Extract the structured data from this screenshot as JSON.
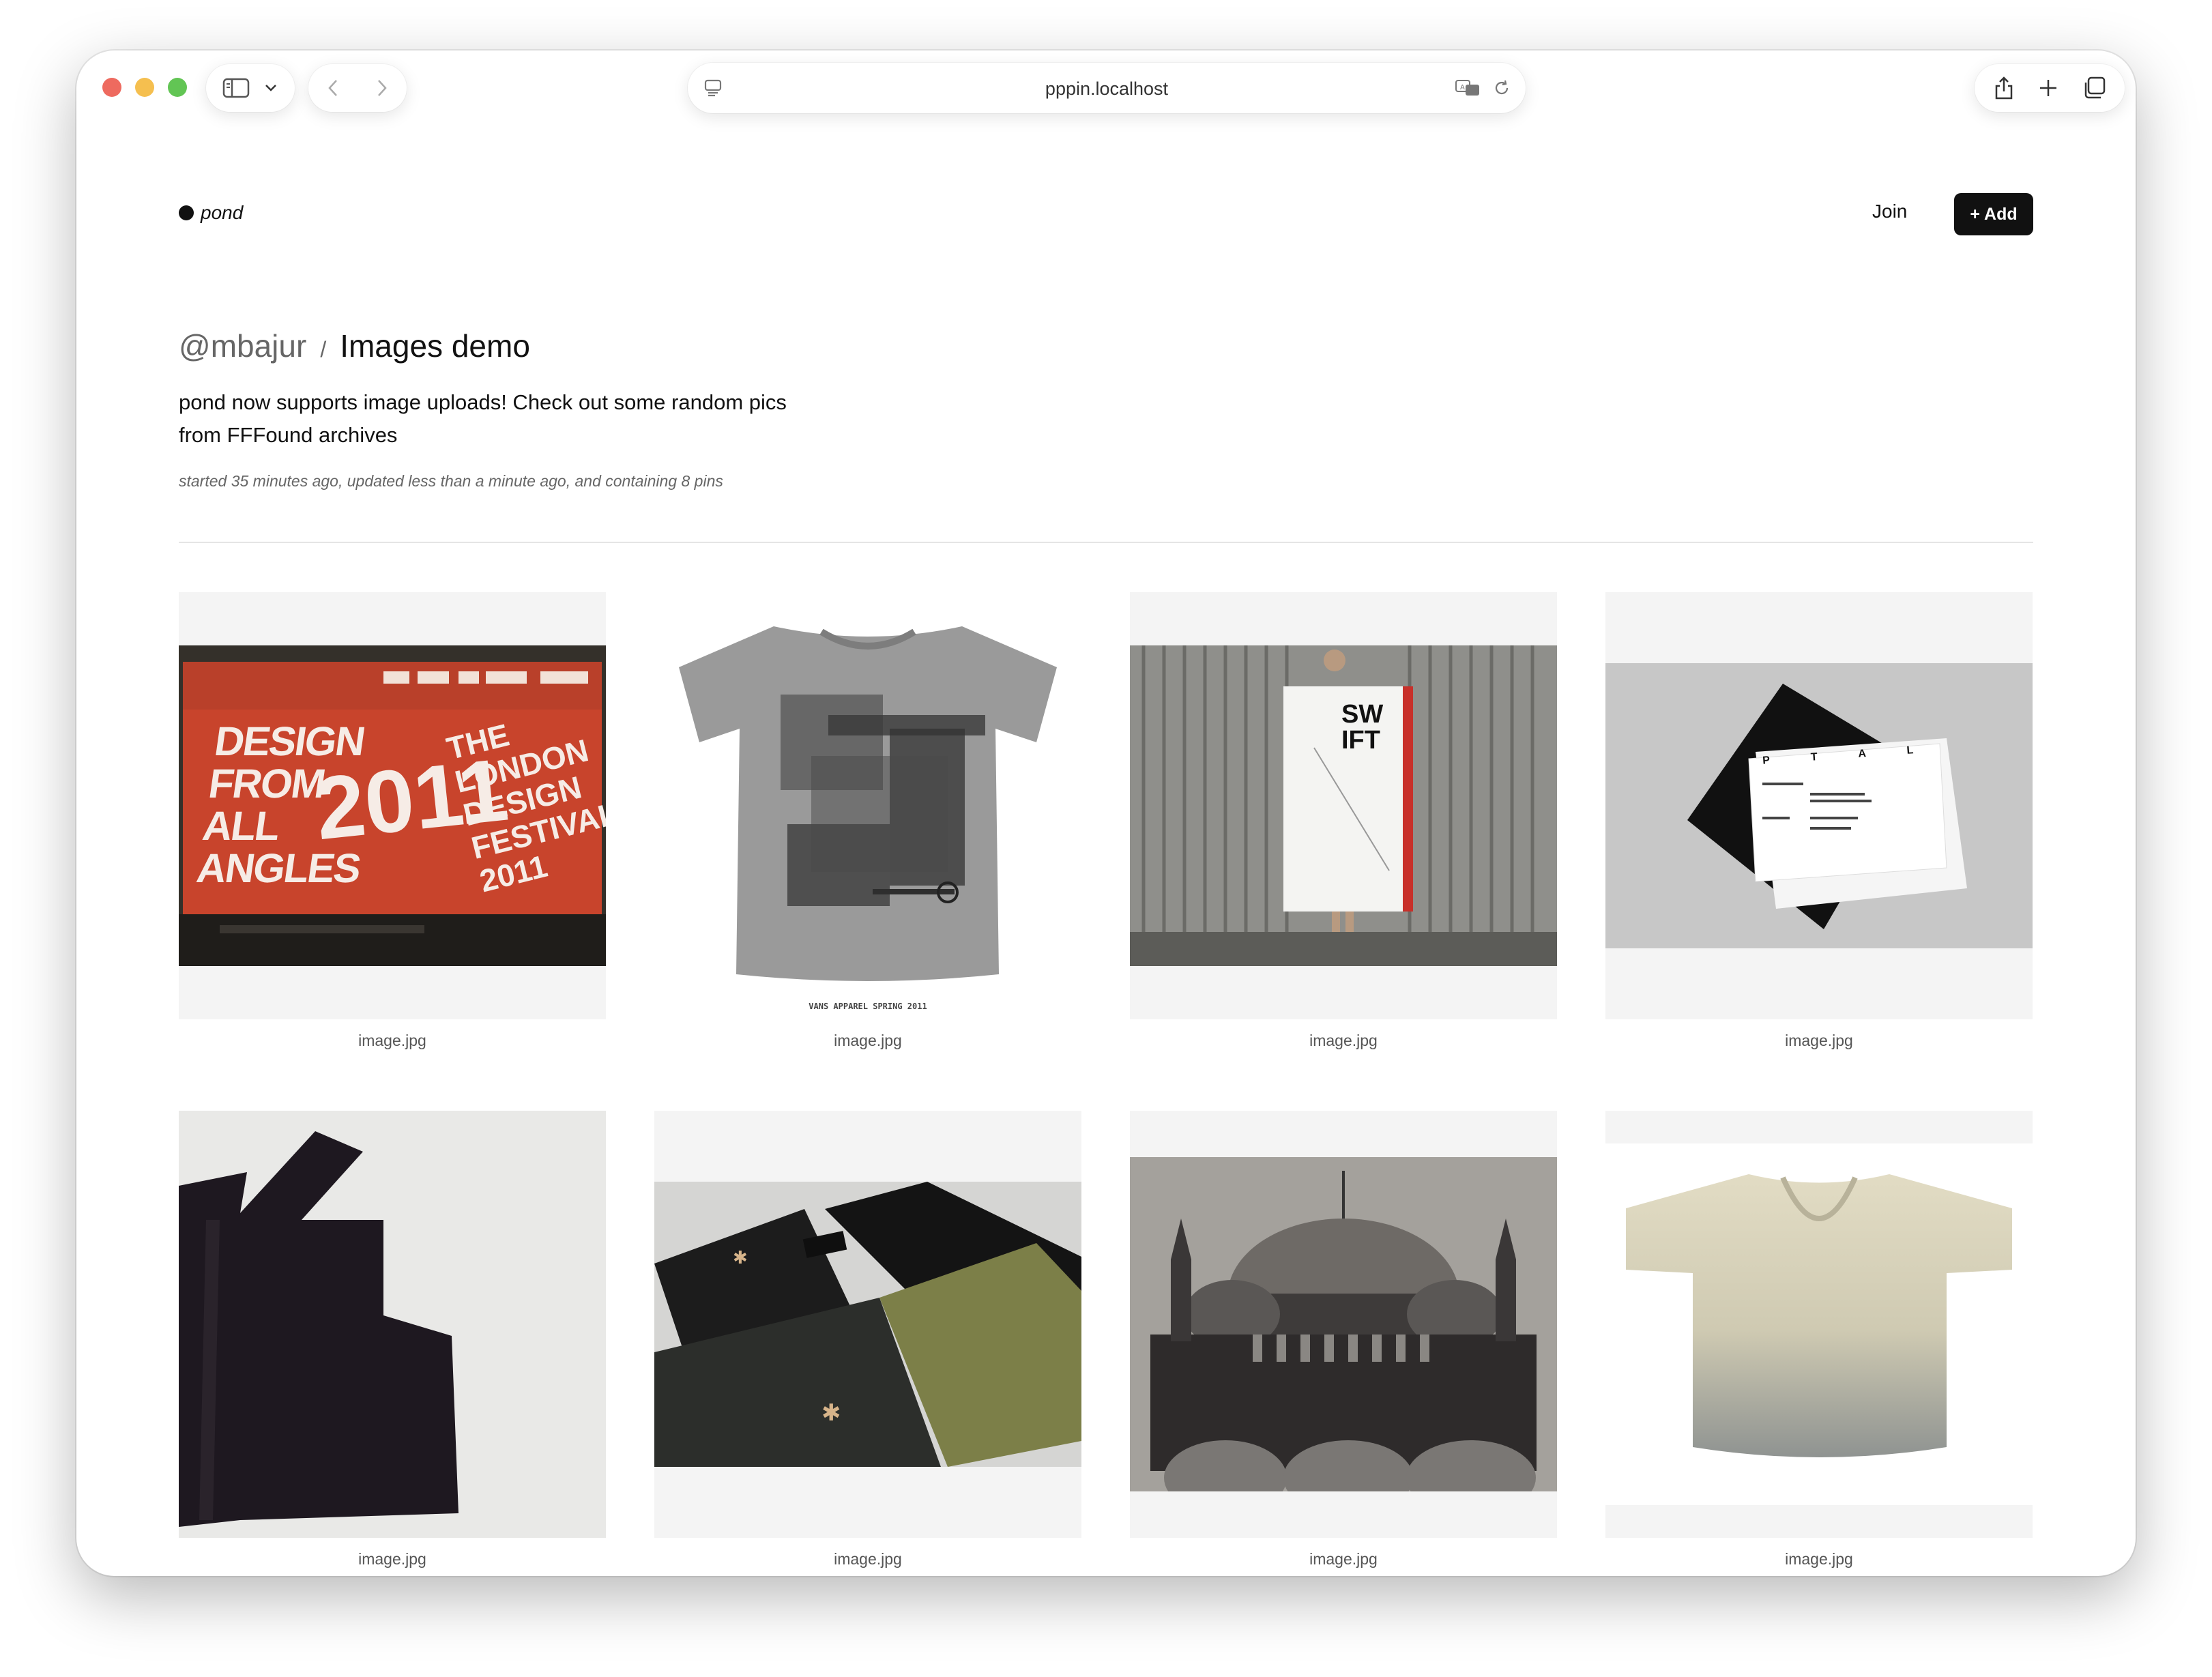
{
  "browser": {
    "url": "pppin.localhost"
  },
  "header": {
    "logo": "pond",
    "join_label": "Join",
    "add_label": "+ Add"
  },
  "collection": {
    "user": "@mbajur",
    "separator": "/",
    "title": "Images demo",
    "description": "pond now supports image uploads! Check out some random pics from FFFound archives",
    "meta": "started 35 minutes ago, updated less than a minute ago, and containing 8 pins"
  },
  "pins": [
    {
      "caption": "image.jpg",
      "poster_text": [
        "DESIGN FROM ALL ANGLES",
        "2011",
        "THE LONDON DESIGN FESTIVAL 2011"
      ]
    },
    {
      "caption": "image.jpg",
      "shirt_text": "VANS APPAREL SPRING 2011"
    },
    {
      "caption": "image.jpg",
      "poster_text": "SW IFT"
    },
    {
      "caption": "image.jpg",
      "card_text": "P T A L"
    },
    {
      "caption": "image.jpg"
    },
    {
      "caption": "image.jpg"
    },
    {
      "caption": "image.jpg"
    },
    {
      "caption": "image.jpg"
    }
  ]
}
